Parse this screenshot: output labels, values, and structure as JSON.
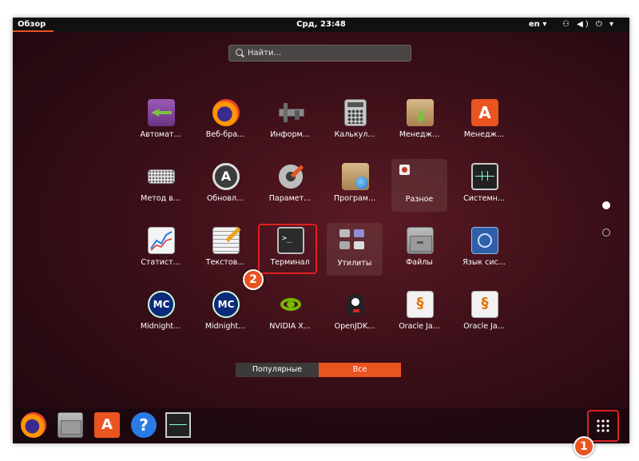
{
  "topbar": {
    "overview": "Обзор",
    "clock": "Срд, 23:48",
    "lang": "en ▾",
    "status": "⚇ ◀) ⏻ ▾"
  },
  "search": {
    "placeholder": "Найти..."
  },
  "apps": [
    {
      "label": "Автомат...",
      "icon": "automation-icon"
    },
    {
      "label": "Веб-бра...",
      "icon": "firefox-icon"
    },
    {
      "label": "Информ...",
      "icon": "caliper-icon"
    },
    {
      "label": "Калькул...",
      "icon": "calculator-icon"
    },
    {
      "label": "Менедж...",
      "icon": "package-install-icon"
    },
    {
      "label": "Менедж...",
      "icon": "software-center-icon"
    },
    {
      "label": "Метод в...",
      "icon": "keyboard-icon"
    },
    {
      "label": "Обновл...",
      "icon": "software-updater-icon"
    },
    {
      "label": "Парамет...",
      "icon": "settings-gear-icon"
    },
    {
      "label": "Програм...",
      "icon": "software-properties-icon"
    },
    {
      "label": "Разное",
      "icon": "misc-folder-icon"
    },
    {
      "label": "Системн...",
      "icon": "system-monitor-icon"
    },
    {
      "label": "Статист...",
      "icon": "statistics-chart-icon"
    },
    {
      "label": "Текстов...",
      "icon": "text-editor-icon"
    },
    {
      "label": "Терминал",
      "icon": "terminal-icon"
    },
    {
      "label": "Утилиты",
      "icon": "utilities-folder-icon"
    },
    {
      "label": "Файлы",
      "icon": "files-icon"
    },
    {
      "label": "Язык сис...",
      "icon": "language-globe-icon"
    },
    {
      "label": "Midnight...",
      "icon": "midnight-commander-icon"
    },
    {
      "label": "Midnight...",
      "icon": "midnight-commander-icon"
    },
    {
      "label": "NVIDIA X...",
      "icon": "nvidia-icon"
    },
    {
      "label": "OpenJDK...",
      "icon": "openjdk-icon"
    },
    {
      "label": "Oracle Ja...",
      "icon": "java-icon"
    },
    {
      "label": "Oracle Ja...",
      "icon": "java-icon"
    }
  ],
  "view_switch": {
    "popular": "Популярные",
    "all": "Все"
  },
  "dash": [
    "firefox-icon",
    "files-icon",
    "software-center-icon",
    "help-icon",
    "system-monitor-icon"
  ],
  "annotations": {
    "badge1": "1",
    "badge2": "2"
  },
  "colors": {
    "accent": "#e95420",
    "highlight": "#e02020"
  }
}
